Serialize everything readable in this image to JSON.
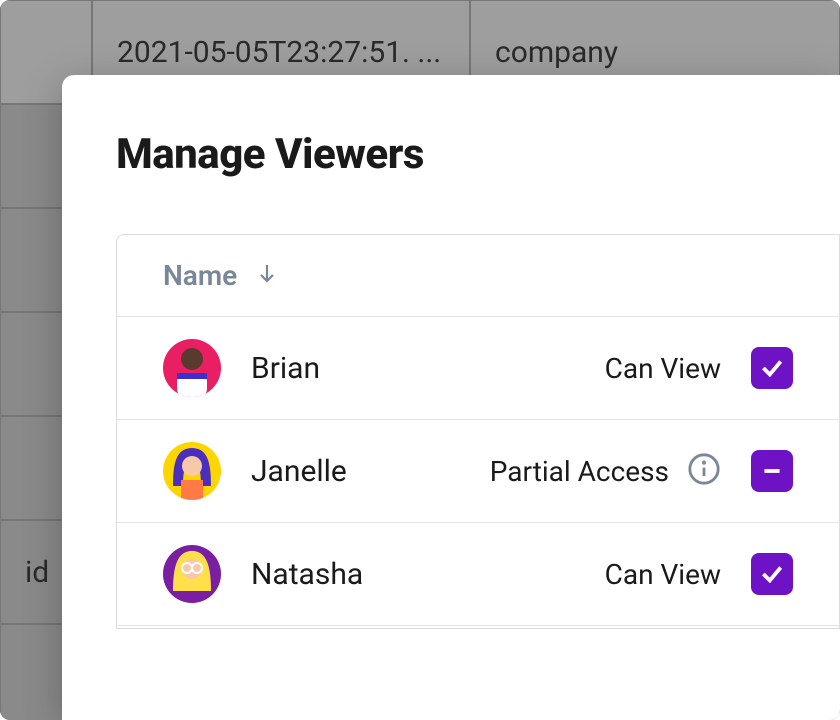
{
  "background_table": {
    "header": {
      "col0": "",
      "col1": "2021-05-05T23:27:51. ...",
      "col2": "company"
    },
    "row2_col0": "id"
  },
  "modal": {
    "title": "Manage Viewers",
    "columns": {
      "name": "Name"
    },
    "rows": [
      {
        "name": "Brian",
        "status": "Can View",
        "has_info": false,
        "check_state": "checked",
        "avatar_class": "av-brian"
      },
      {
        "name": "Janelle",
        "status": "Partial Access",
        "has_info": true,
        "check_state": "indeterminate",
        "avatar_class": "av-janelle"
      },
      {
        "name": "Natasha",
        "status": "Can View",
        "has_info": false,
        "check_state": "checked",
        "avatar_class": "av-natasha"
      }
    ]
  },
  "colors": {
    "accent": "#6d12c4"
  }
}
